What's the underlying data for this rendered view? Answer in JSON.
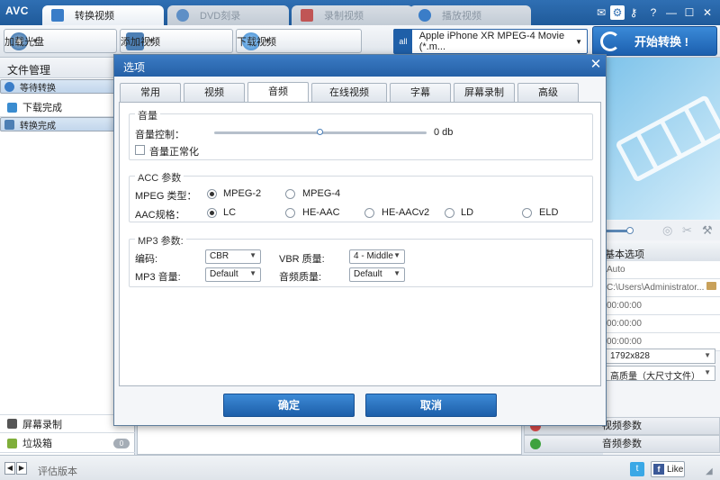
{
  "app": {
    "logo": "AVC",
    "tabs": [
      {
        "label": "转换视频",
        "active": true
      },
      {
        "label": "DVD刻录",
        "active": false
      },
      {
        "label": "录制视频",
        "active": false
      },
      {
        "label": "播放视频",
        "active": false
      }
    ],
    "window_buttons": [
      "?",
      "—",
      "☐",
      "✕"
    ]
  },
  "toolbar": {
    "load_disc": "加载光盘",
    "add_video": "添加视频",
    "download_video": "下载视频",
    "profile": "Apple iPhone XR MPEG-4 Movie (*.m...",
    "convert": "开始转换 !"
  },
  "sidebar": {
    "title": "文件管理",
    "items": [
      {
        "label": "等待转换"
      },
      {
        "label": "下载完成"
      },
      {
        "label": "转换完成"
      }
    ],
    "bottom": [
      {
        "label": "屏幕录制",
        "count": ""
      },
      {
        "label": "垃圾箱",
        "count": "0"
      }
    ]
  },
  "right_panel": {
    "basic_options": "基本选项",
    "rows": [
      "Auto",
      "C:\\Users\\Administrator...",
      "00:00:00",
      "00:00:00",
      "00:00:00"
    ],
    "resolution": "1792x828",
    "quality": "高质量（大尺寸文件）",
    "video_params": "视频参数",
    "audio_params": "音频参数"
  },
  "dialog": {
    "title": "选项",
    "tabs": [
      {
        "label": "常用",
        "active": false
      },
      {
        "label": "视频",
        "active": false
      },
      {
        "label": "音频",
        "active": true
      },
      {
        "label": "在线视频",
        "active": false
      },
      {
        "label": "字幕",
        "active": false
      },
      {
        "label": "屏幕录制",
        "active": false
      },
      {
        "label": "高级",
        "active": false
      }
    ],
    "volume_group": {
      "title": "音量",
      "volume_label": "音量控制：",
      "volume_value": "0 db",
      "volume_level": 0.5,
      "normalize_label": "音量正常化",
      "normalize_checked": false
    },
    "acc_group": {
      "title": "ACC 参数",
      "mpeg_label": "MPEG 类型：",
      "mpeg_options": [
        {
          "label": "MPEG-2",
          "selected": true
        },
        {
          "label": "MPEG-4",
          "selected": false
        }
      ],
      "aac_label": "AAC规格：",
      "aac_options": [
        {
          "label": "LC",
          "selected": true
        },
        {
          "label": "HE-AAC",
          "selected": false
        },
        {
          "label": "HE-AACv2",
          "selected": false
        },
        {
          "label": "LD",
          "selected": false
        },
        {
          "label": "ELD",
          "selected": false
        }
      ]
    },
    "mp3_group": {
      "title": "MP3 参数:",
      "encoding_label": "编码:",
      "encoding_value": "CBR",
      "vbr_label": "VBR 质量:",
      "vbr_value": "4 - Middle",
      "mp3_volume_label": "MP3 音量:",
      "mp3_volume_value": "Default",
      "audio_quality_label": "音频质量:",
      "audio_quality_value": "Default"
    },
    "ok": "确定",
    "cancel": "取消"
  },
  "status": {
    "text": "评估版本",
    "facebook_like": "Like"
  },
  "colors": {
    "accent": "#1f5fa8",
    "button": "#2a73c0",
    "title_bar": "#2f6fb3"
  }
}
